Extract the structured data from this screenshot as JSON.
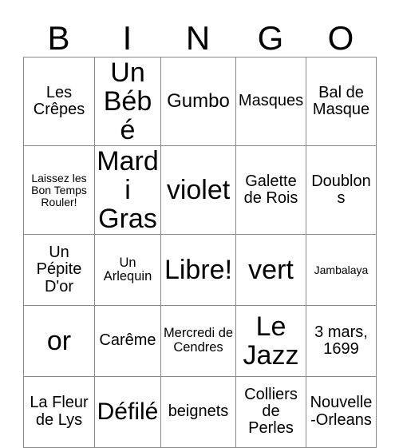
{
  "card": {
    "title": "BINGO",
    "headers": [
      "B",
      "I",
      "N",
      "G",
      "O"
    ],
    "colors": {
      "background": "#ffffff",
      "text": "#000000",
      "grid_line": "#8a8a8a",
      "grid_outer": "#6b6b6b"
    },
    "rows": [
      [
        {
          "text": "Les Crêpes",
          "size": "md"
        },
        {
          "text": "Un Bébé",
          "size": "xxl"
        },
        {
          "text": "Gumbo",
          "size": "lg"
        },
        {
          "text": "Masques",
          "size": "md"
        },
        {
          "text": "Bal de Masque",
          "size": "md"
        }
      ],
      [
        {
          "text": "Laissez les Bon Temps Rouler!",
          "size": "xs"
        },
        {
          "text": "Mardi Gras",
          "size": "xxl"
        },
        {
          "text": "violet",
          "size": "xxl"
        },
        {
          "text": "Galette de Rois",
          "size": "md"
        },
        {
          "text": "Doublons",
          "size": "md"
        }
      ],
      [
        {
          "text": "Un Pépite D'or",
          "size": "md"
        },
        {
          "text": "Un Arlequin",
          "size": "sm"
        },
        {
          "text": "Libre!",
          "size": "xxl"
        },
        {
          "text": "vert",
          "size": "xxl"
        },
        {
          "text": "Jambalaya",
          "size": "xs"
        }
      ],
      [
        {
          "text": "or",
          "size": "xxl"
        },
        {
          "text": "Carême",
          "size": "md"
        },
        {
          "text": "Mercredi de Cendres",
          "size": "sm"
        },
        {
          "text": "Le Jazz",
          "size": "xxl"
        },
        {
          "text": "3 mars, 1699",
          "size": "md"
        }
      ],
      [
        {
          "text": "La Fleur de Lys",
          "size": "md"
        },
        {
          "text": "Défilé",
          "size": "xl"
        },
        {
          "text": "beignets",
          "size": "md"
        },
        {
          "text": "Colliers de Perles",
          "size": "md"
        },
        {
          "text": "Nouvelle-Orleans",
          "size": "md"
        }
      ]
    ]
  }
}
